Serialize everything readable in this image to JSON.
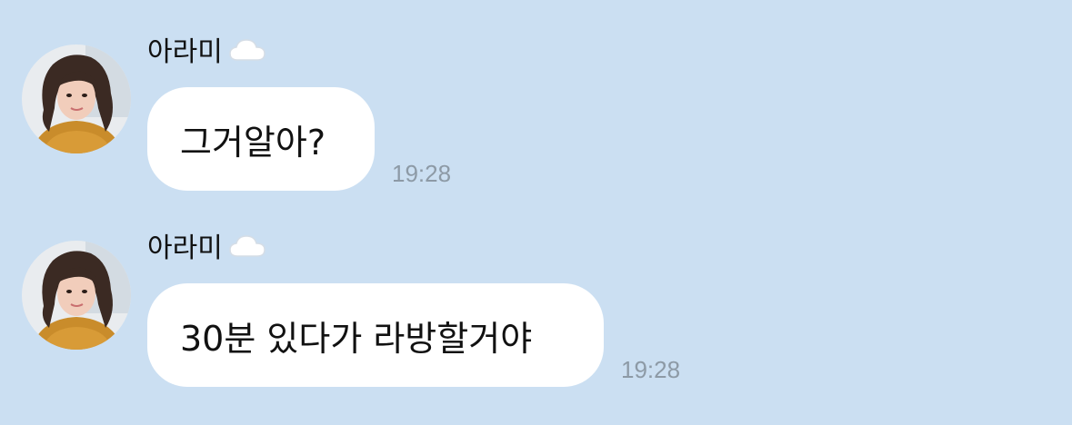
{
  "chat": {
    "messages": [
      {
        "sender": "아라미",
        "status_icon": "cloud-icon",
        "avatar": "profile-photo",
        "text": "그거알아?",
        "time": "19:28"
      },
      {
        "sender": "아라미",
        "status_icon": "cloud-icon",
        "avatar": "profile-photo",
        "text": "30분 있다가 라방할거야",
        "time": "19:28"
      }
    ]
  },
  "colors": {
    "background": "#cbdff2",
    "bubble": "#ffffff",
    "time": "#8d9aa6"
  }
}
